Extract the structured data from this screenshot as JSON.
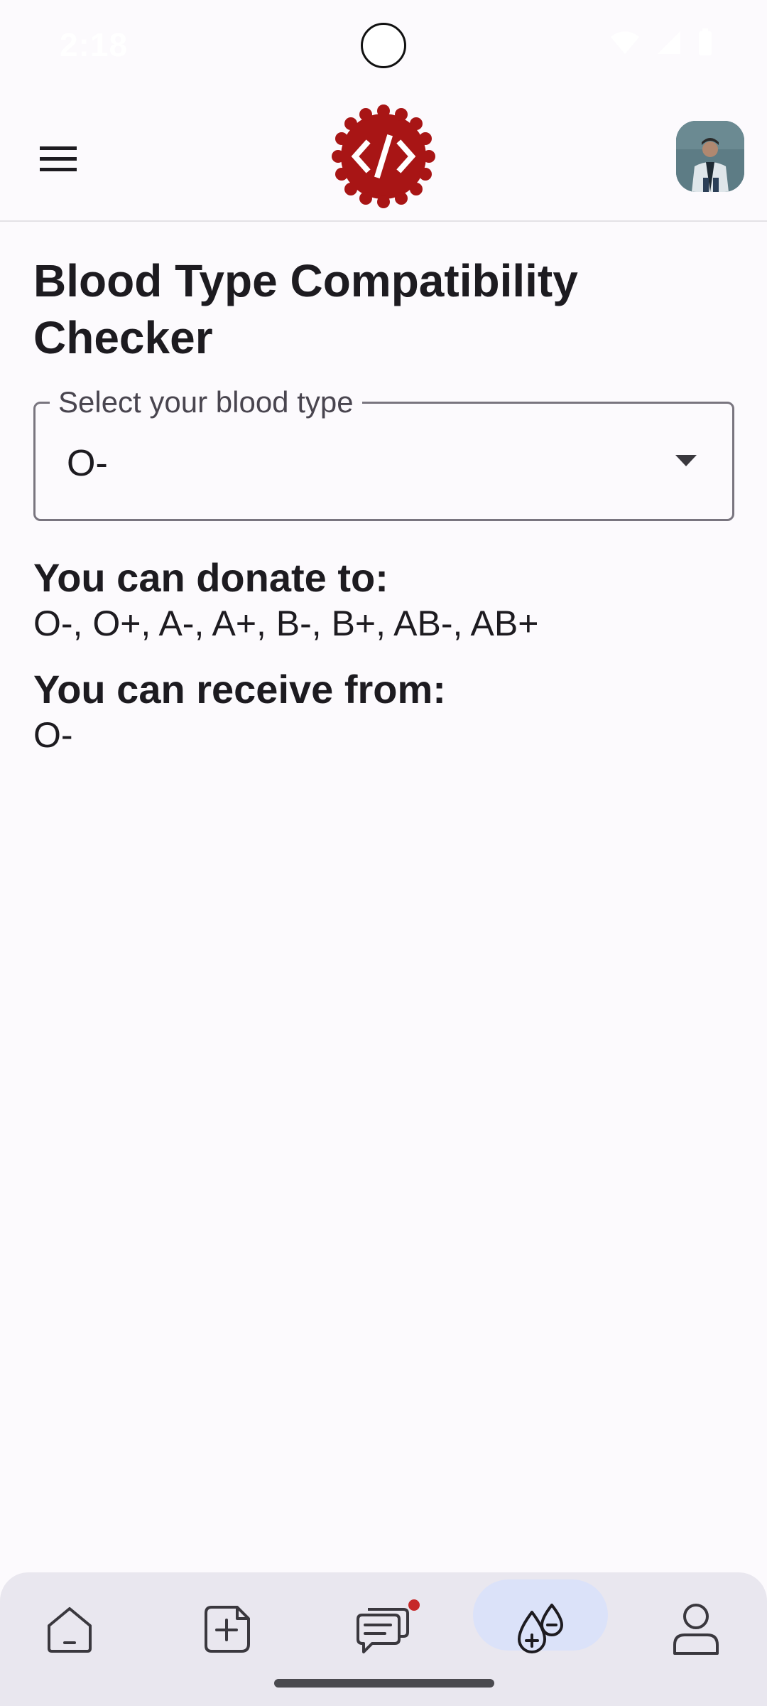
{
  "status_bar": {
    "time": "2:18"
  },
  "header": {
    "menu_icon": "hamburger-menu-icon",
    "logo_icon": "code-badge-logo",
    "avatar_icon": "user-avatar-photo",
    "brand_color": "#a81515"
  },
  "main": {
    "title": "Blood Type Compatibility Checker",
    "select": {
      "label": "Select your blood type",
      "value": "O-"
    },
    "donate": {
      "heading": "You can donate to:",
      "value": "O-, O+, A-, A+, B-, B+, AB-, AB+"
    },
    "receive": {
      "heading": "You can receive from:",
      "value": "O-"
    }
  },
  "bottom_nav": {
    "items": [
      {
        "icon": "home-icon",
        "active": false
      },
      {
        "icon": "add-post-icon",
        "active": false
      },
      {
        "icon": "chat-icon",
        "active": false,
        "badge": true
      },
      {
        "icon": "blood-drop-icon",
        "active": true
      },
      {
        "icon": "profile-icon",
        "active": false
      }
    ],
    "active_color": "#dbe2f9",
    "badge_color": "#c62828"
  }
}
